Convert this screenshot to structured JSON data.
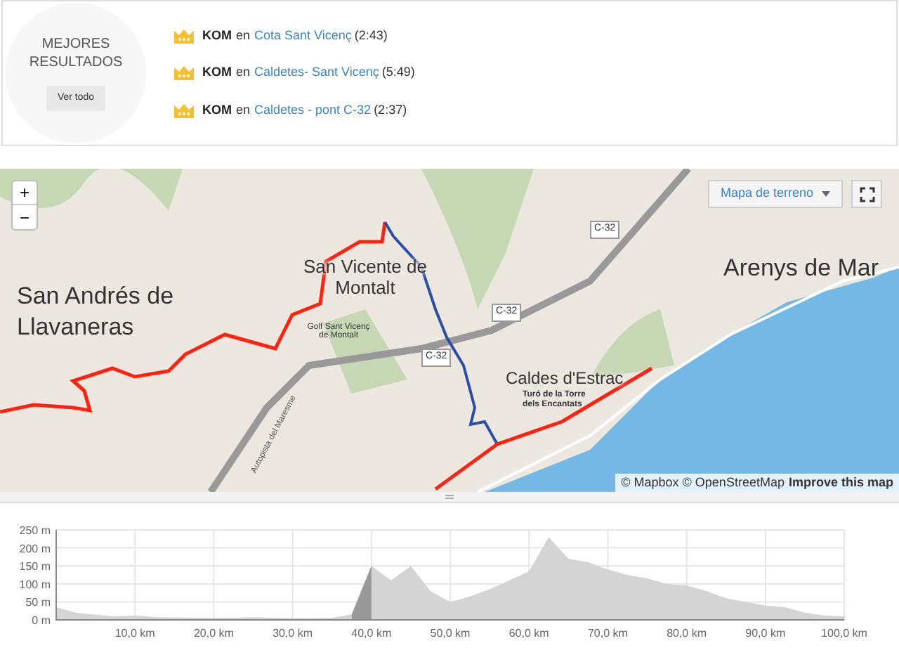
{
  "best_results": {
    "title": "MEJORES RESULTADOS",
    "button": "Ver todo",
    "items": [
      {
        "award": "KOM",
        "connector": "en",
        "segment": "Cota Sant Vicenç",
        "time": "(2:43)"
      },
      {
        "award": "KOM",
        "connector": "en",
        "segment": "Caldetes- Sant Vicenç",
        "time": "(5:49)"
      },
      {
        "award": "KOM",
        "connector": "en",
        "segment": "Caldetes - pont C-32",
        "time": "(2:37)"
      }
    ]
  },
  "map": {
    "zoom_in": "+",
    "zoom_out": "−",
    "layer_select": "Mapa de terreno",
    "attribution": "© Mapbox © OpenStreetMap",
    "improve_link": "Improve this map",
    "labels": [
      {
        "text": "San Andrés de Llavaneras",
        "kind": "town"
      },
      {
        "text": "San Vicente de Montalt",
        "kind": "town"
      },
      {
        "text": "Arenys de Mar",
        "kind": "town"
      },
      {
        "text": "Caldes d'Estrac",
        "kind": "town"
      },
      {
        "text": "Turó de la Torre dels Encantats",
        "kind": "poi"
      },
      {
        "text": "C-32",
        "kind": "road"
      },
      {
        "text": "C-32",
        "kind": "road"
      },
      {
        "text": "C-32",
        "kind": "road"
      },
      {
        "text": "Autopista del Maresme",
        "kind": "street"
      },
      {
        "text": "Golf Sant Vicenç de Montalt",
        "kind": "poi"
      }
    ]
  },
  "elevation": {
    "chart_data": {
      "type": "area",
      "x": [
        0,
        2.5,
        5,
        7.5,
        10,
        12.5,
        15,
        17.5,
        20,
        22.5,
        25,
        27.5,
        30,
        32.5,
        35,
        37.5,
        40,
        42.5,
        45,
        47.5,
        50,
        52.5,
        55,
        57.5,
        60,
        62.5,
        65,
        67.5,
        70,
        72.5,
        75,
        77.5,
        80,
        82.5,
        85,
        87.5,
        90,
        92.5,
        95,
        97.5,
        100
      ],
      "grid": true,
      "series": [
        {
          "color": "#d4d4d4",
          "values": [
            35,
            20,
            14,
            10,
            12,
            8,
            7,
            6,
            6,
            6,
            8,
            6,
            5,
            5,
            6,
            15,
            150,
            110,
            150,
            80,
            50,
            65,
            85,
            110,
            135,
            230,
            170,
            160,
            140,
            125,
            115,
            100,
            95,
            80,
            60,
            50,
            40,
            35,
            20,
            12,
            10
          ]
        },
        {
          "color": "#999999",
          "values": [
            null,
            null,
            null,
            null,
            null,
            null,
            null,
            null,
            null,
            null,
            null,
            null,
            null,
            null,
            null,
            15,
            150,
            null,
            null,
            null,
            null,
            null,
            null,
            null,
            null,
            null,
            null,
            null,
            null,
            null,
            null,
            null,
            null,
            null,
            null,
            null,
            null,
            null,
            null,
            null,
            null
          ]
        }
      ],
      "xlim": [
        0,
        100
      ],
      "ylim": [
        0,
        250
      ],
      "xticks": [
        {
          "value": 10,
          "label": "10,0 km"
        },
        {
          "value": 20,
          "label": "20,0 km"
        },
        {
          "value": 30,
          "label": "30,0 km"
        },
        {
          "value": 40,
          "label": "40,0 km"
        },
        {
          "value": 50,
          "label": "50,0 km"
        },
        {
          "value": 60,
          "label": "60,0 km"
        },
        {
          "value": 70,
          "label": "70,0 km"
        },
        {
          "value": 80,
          "label": "80,0 km"
        },
        {
          "value": 90,
          "label": "90,0 km"
        },
        {
          "value": 100,
          "label": "100,0 km"
        }
      ],
      "yticks": [
        {
          "value": 0,
          "label": "0 m"
        },
        {
          "value": 50,
          "label": "50 m"
        },
        {
          "value": 100,
          "label": "100 m"
        },
        {
          "value": 150,
          "label": "150 m"
        },
        {
          "value": 200,
          "label": "200 m"
        },
        {
          "value": 250,
          "label": "250 m"
        }
      ]
    }
  }
}
